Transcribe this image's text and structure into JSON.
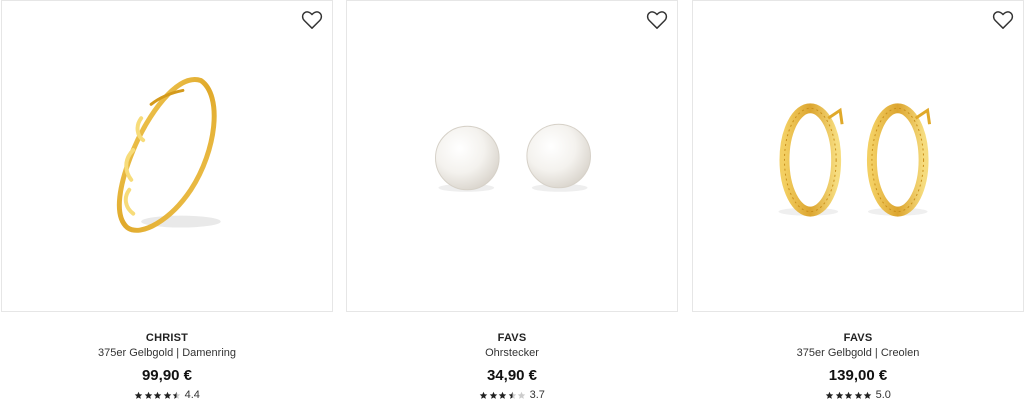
{
  "colors": {
    "star_filled": "#222222",
    "star_empty": "#cccccc",
    "border": "#e6e6e6",
    "gold": "#e3b23c"
  },
  "products": [
    {
      "brand": "CHRIST",
      "title": "375er Gelbgold | Damenring",
      "price": "99,90 €",
      "rating_value": 4.4,
      "rating_text": "4.4",
      "image_icon": "gold-twisted-ring",
      "wishlist_icon": "heart-outline-icon"
    },
    {
      "brand": "FAVS",
      "title": "Ohrstecker",
      "price": "34,90 €",
      "rating_value": 3.7,
      "rating_text": "3.7",
      "image_icon": "pearl-stud-earrings",
      "wishlist_icon": "heart-outline-icon"
    },
    {
      "brand": "FAVS",
      "title": "375er Gelbgold | Creolen",
      "price": "139,00 €",
      "rating_value": 5.0,
      "rating_text": "5.0",
      "image_icon": "gold-hoop-earrings",
      "wishlist_icon": "heart-outline-icon"
    }
  ]
}
